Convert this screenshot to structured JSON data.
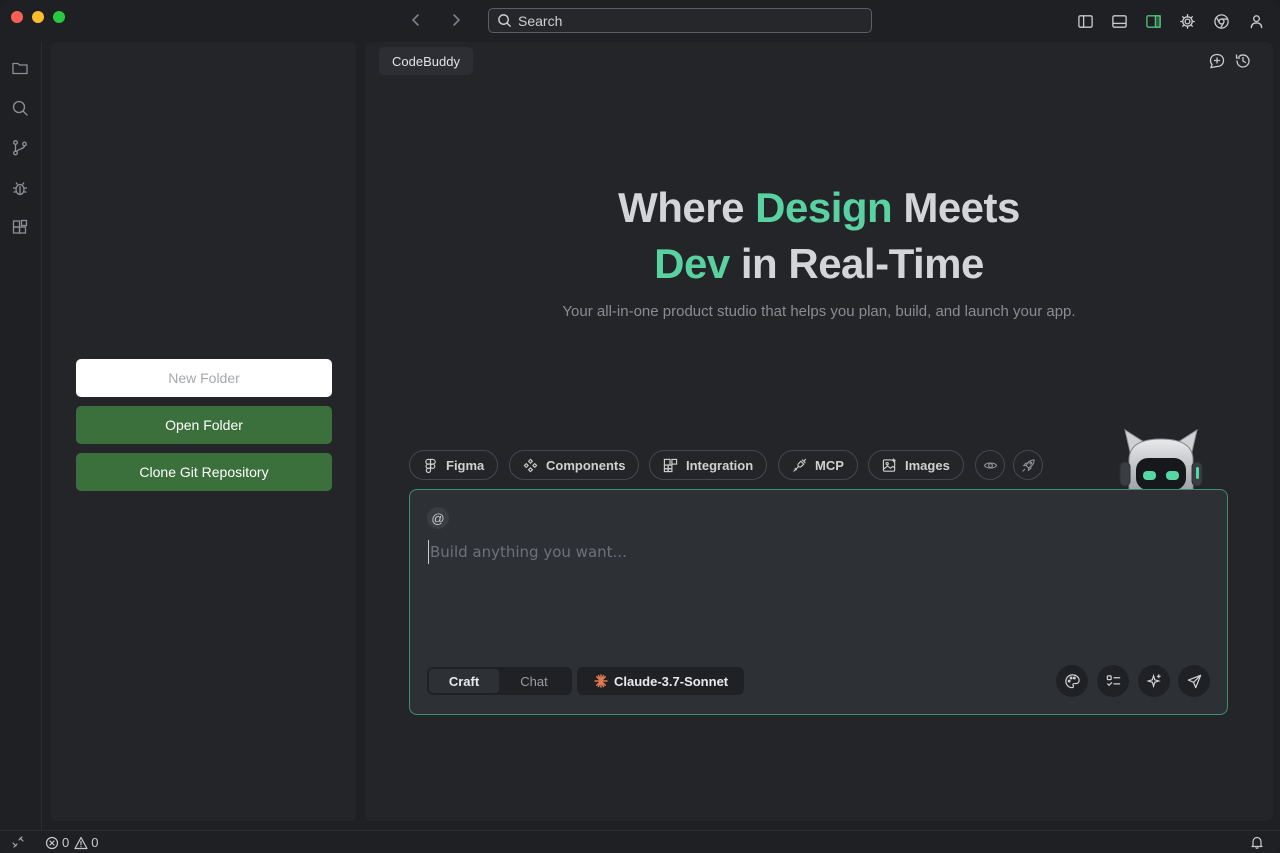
{
  "titlebar": {
    "search_placeholder": "Search"
  },
  "sidebar": {
    "new_folder_label": "New Folder",
    "open_folder_label": "Open Folder",
    "clone_repo_label": "Clone Git Repository"
  },
  "main": {
    "tab_label": "CodeBuddy",
    "hero": {
      "line1_part1": "Where ",
      "line1_accent": "Design",
      "line1_part2": " Meets",
      "line2_accent": "Dev",
      "line2_part2": " in Real-Time"
    },
    "subtitle": "Your all-in-one product studio that helps you plan, build, and launch your app.",
    "chips": [
      {
        "label": "Figma",
        "icon": "figma-icon"
      },
      {
        "label": "Components",
        "icon": "components-icon"
      },
      {
        "label": "Integration",
        "icon": "integration-icon"
      },
      {
        "label": "MCP",
        "icon": "plug-icon"
      },
      {
        "label": "Images",
        "icon": "image-icon"
      }
    ],
    "composer": {
      "at_symbol": "@",
      "placeholder": "Build anything you want...",
      "value": "",
      "modes": [
        "Craft",
        "Chat"
      ],
      "active_mode": "Craft",
      "model": "Claude-3.7-Sonnet"
    }
  },
  "statusbar": {
    "errors": "0",
    "warnings": "0"
  },
  "colors": {
    "accent": "#5ad1a0",
    "button_green": "#3b6f3b",
    "composer_border": "#3f8f6e"
  }
}
